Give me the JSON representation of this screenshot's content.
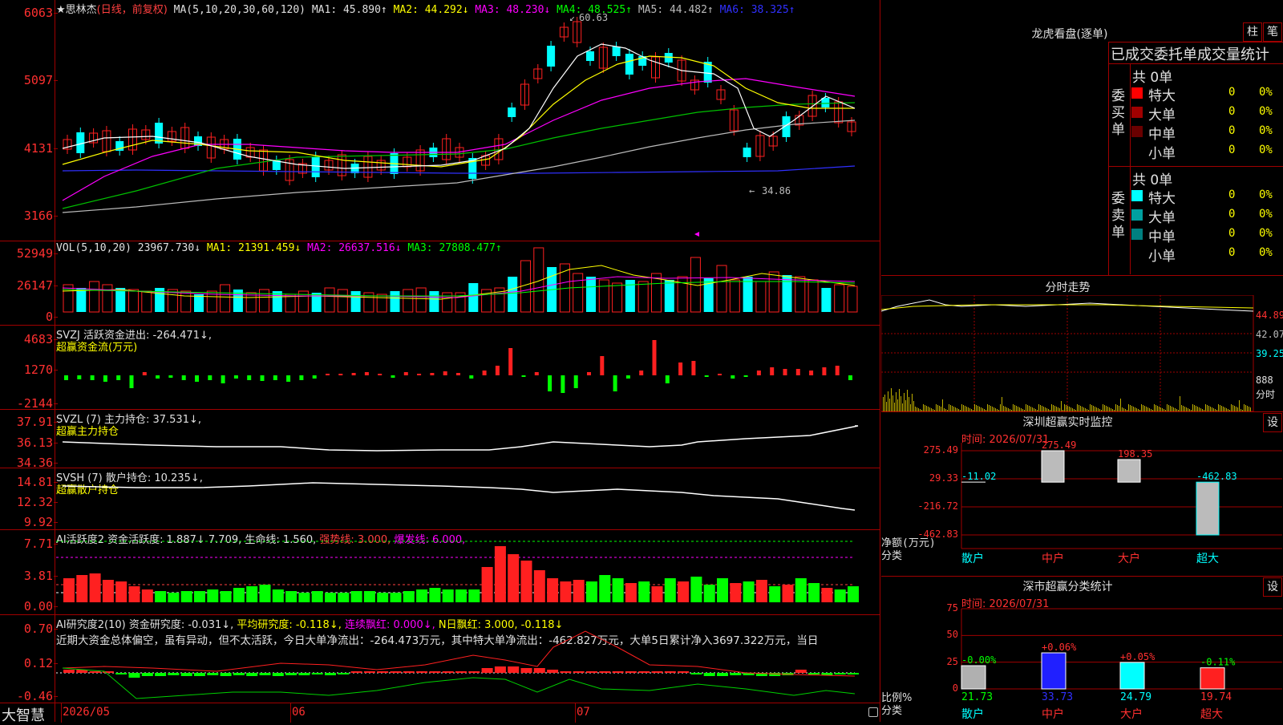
{
  "main_chart": {
    "stock_title": "★思林杰",
    "period": "(日线，前复权)",
    "ma_params": "MA(5,10,20,30,60,120)",
    "ma1": "MA1: 45.890↑",
    "ma2": "MA2: 44.292↓",
    "ma3": "MA3: 48.230↓",
    "ma4": "MA4: 48.525↑",
    "ma5": "MA5: 44.482↑",
    "ma6": "MA6: 38.325↑",
    "y_labels": [
      "6063",
      "5097",
      "4131",
      "3166"
    ],
    "high_mark": "60.63",
    "low_mark": "34.86"
  },
  "vol": {
    "title": "VOL(5,10,20)",
    "value": "23967.730↓",
    "ma1": "MA1: 21391.459↓",
    "ma2": "MA2: 26637.516↓",
    "ma3": "MA3: 27808.477↑",
    "y_labels": [
      "52949",
      "26147",
      "0"
    ]
  },
  "svzj": {
    "title": "SVZJ  活跃资金进出: -264.471↓,",
    "subtitle": "超赢资金流(万元)",
    "y_labels": [
      "4683",
      "1270",
      "-2144"
    ]
  },
  "svzl": {
    "title": "SVZL (7) 主力持仓: 37.531↓,",
    "subtitle": "超赢主力持仓",
    "y_labels": [
      "37.91",
      "36.13",
      "34.36"
    ]
  },
  "svsh": {
    "title": "SVSH (7) 散户持仓: 10.235↓,",
    "subtitle": "超赢散户持仓",
    "y_labels": [
      "14.81",
      "12.32",
      "9.92"
    ]
  },
  "ai1": {
    "title": "AI活跃度2 资金活跃度: 1.887↓",
    "v2": "7.709,",
    "life": "生命线: 1.560,",
    "strong": "强势线: 3.000,",
    "burst": "爆发线: 6.000,",
    "y_labels": [
      "7.71",
      "3.81",
      "0.00"
    ]
  },
  "ai2": {
    "title": "AI研究度2(10) 资金研究度: -0.031↓,",
    "avg": "平均研究度: -0.118↓,",
    "red": "连续飘红: 0.000↓,",
    "nday": "N日飘红: 3.000, -0.118↓",
    "text": "近期大资金总体偏空，虽有异动，但不太活跃，今日大单净流出：-264.473万元，其中特大单净流出：-462.827万元，大单5日累计净入3697.322万元，当日",
    "y_labels": [
      "0.70",
      "0.12",
      "-0.46"
    ]
  },
  "bottom_bar": {
    "brand": "大智慧",
    "dates": [
      "2026/05",
      "06",
      "07"
    ]
  },
  "dragon_tiger": {
    "title": "龙虎看盘(逐单)",
    "btn_bar": "柱",
    "btn_pen": "笔",
    "header": "已成交委托单成交量统计",
    "buy_label": "委买单",
    "sell_label": "委卖单",
    "buy_total": "共 0单",
    "sell_total": "共 0单",
    "buy_rows": [
      {
        "name": "特大",
        "count": "0",
        "pct": "0%",
        "color": "#ff0000"
      },
      {
        "name": "大单",
        "count": "0",
        "pct": "0%",
        "color": "#a00000"
      },
      {
        "name": "中单",
        "count": "0",
        "pct": "0%",
        "color": "#6a0000"
      },
      {
        "name": "小单",
        "count": "0",
        "pct": "0%",
        "color": "#000000"
      }
    ],
    "sell_rows": [
      {
        "name": "特大",
        "count": "0",
        "pct": "0%",
        "color": "#00ffff"
      },
      {
        "name": "大单",
        "count": "0",
        "pct": "0%",
        "color": "#00a0a0"
      },
      {
        "name": "中单",
        "count": "0",
        "pct": "0%",
        "color": "#008080"
      },
      {
        "name": "小单",
        "count": "0",
        "pct": "0%",
        "color": "#000000"
      }
    ]
  },
  "intraday": {
    "title": "分时走势",
    "y_labels": [
      "44.89",
      "42.07",
      "39.25",
      "888",
      "分时"
    ]
  },
  "monitor": {
    "title": "深圳超赢实时监控",
    "btn": "设",
    "time": "时间: 2026/07/31",
    "y_labels": [
      "275.49",
      "29.33",
      "-216.72",
      "-462.83"
    ],
    "ylabel": "净额(万元)",
    "xlabel": "分类",
    "categories": [
      "散户",
      "中户",
      "大户",
      "超大"
    ],
    "values": [
      "-11.02",
      "275.49",
      "198.35",
      "-462.83"
    ]
  },
  "classify": {
    "title": "深市超赢分类统计",
    "btn": "设",
    "time": "时间: 2026/07/31",
    "y_labels": [
      "75",
      "50",
      "25",
      "0"
    ],
    "ylabel": "比例%",
    "xlabel": "分类",
    "categories": [
      "散户",
      "中户",
      "大户",
      "超大"
    ],
    "changes": [
      "-0.00%",
      "+0.06%",
      "+0.05%",
      "-0.11%"
    ],
    "values": [
      "21.73",
      "33.73",
      "24.79",
      "19.74"
    ]
  },
  "chart_data": [
    {
      "type": "bar",
      "title": "深圳超赢实时监控",
      "ylabel": "净额(万元)",
      "xlabel": "分类",
      "categories": [
        "散户",
        "中户",
        "大户",
        "超大"
      ],
      "values": [
        -11.02,
        275.49,
        198.35,
        -462.83
      ],
      "ylim": [
        -462.83,
        275.49
      ]
    },
    {
      "type": "bar",
      "title": "深市超赢分类统计",
      "ylabel": "比例%",
      "xlabel": "分类",
      "categories": [
        "散户",
        "中户",
        "大户",
        "超大"
      ],
      "values": [
        21.73,
        33.73,
        24.79,
        19.74
      ],
      "ylim": [
        0,
        75
      ]
    }
  ]
}
